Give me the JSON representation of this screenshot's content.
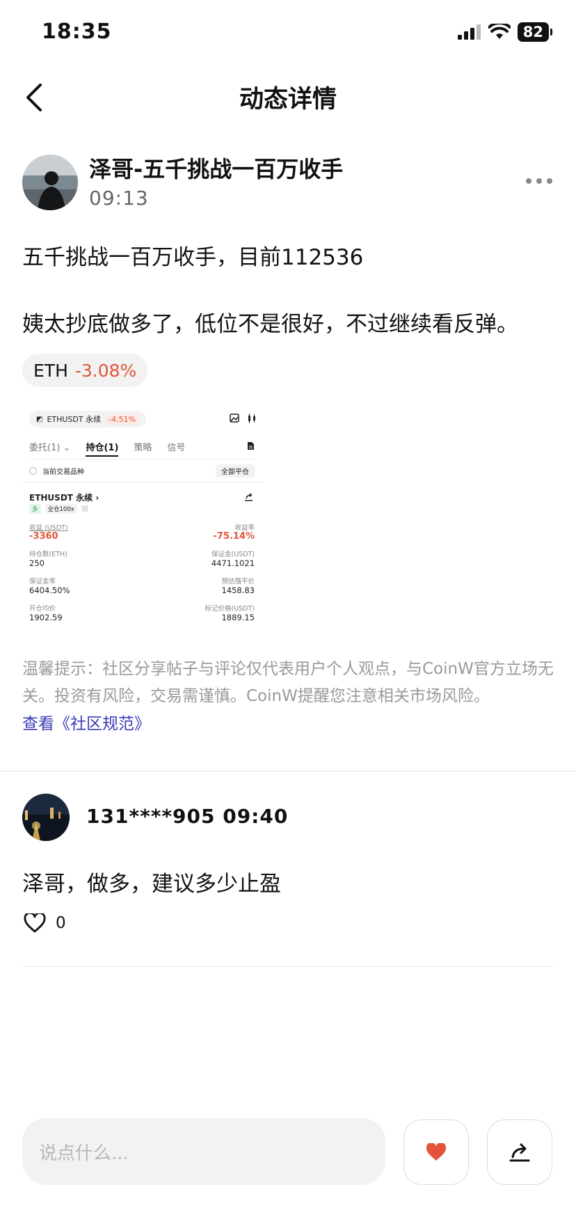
{
  "status_bar": {
    "time": "18:35",
    "battery": "82"
  },
  "nav": {
    "title": "动态详情"
  },
  "post": {
    "author": "泽哥-五千挑战一百万收手",
    "time": "09:13",
    "line1": "五千挑战一百万收手，目前112536",
    "line2": "姨太抄底做多了，低位不是很好，不过继续看反弹。",
    "tag": {
      "symbol": "ETH",
      "change": "-3.08%"
    }
  },
  "shot": {
    "pair": "ETHUSDT 永续",
    "pair_change": "-4.51%",
    "tabs": [
      "委托(1)",
      "持仓(1)",
      "策略",
      "信号"
    ],
    "current_only": "当前交易品种",
    "close_all": "全部平仓",
    "position_title": "ETHUSDT 永续",
    "side": "多",
    "margin_mode": "全仓100x",
    "pnl_label": "收益 (USDT)",
    "pnl_value": "-3360",
    "roe_label": "收益率",
    "roe_value": "-75.14%",
    "size_label": "持仓数(ETH)",
    "size_value": "250",
    "margin_label": "保证金(USDT)",
    "margin_value": "4471.1021",
    "margin_rate_label": "保证金率",
    "margin_rate_value": "6404.50%",
    "liq_label": "预估强平价",
    "liq_value": "1458.83",
    "entry_label": "开仓均价",
    "entry_value": "1902.59",
    "mark_label": "标记价格(USDT)",
    "mark_value": "1889.15"
  },
  "notice": {
    "text": "温馨提示：社区分享帖子与评论仅代表用户个人观点，与CoinW官方立场无关。投资有风险，交易需谨慎。CoinW提醒您注意相关市场风险。",
    "link": "查看《社区规范》"
  },
  "comment": {
    "user": "131****905 09:40",
    "text": "泽哥，做多，建议多少止盈",
    "likes": "0"
  },
  "bottom_bar": {
    "placeholder": "说点什么..."
  },
  "colors": {
    "accent_red": "#e2553b",
    "link_blue": "#3a3ab8"
  }
}
